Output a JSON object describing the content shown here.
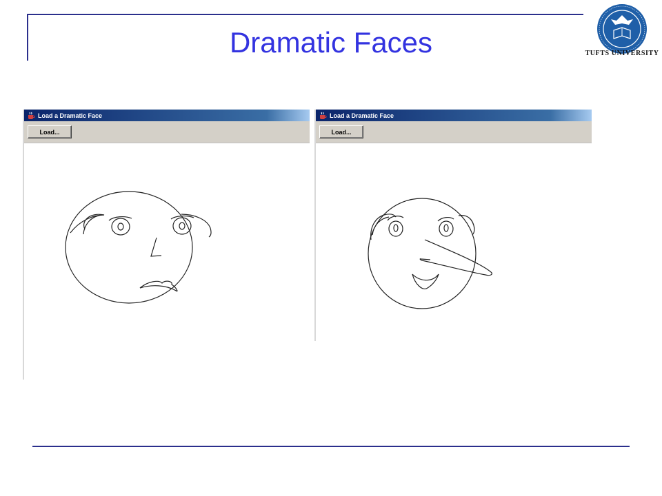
{
  "slide": {
    "title": "Dramatic Faces"
  },
  "branding": {
    "university_name": "TUFTS UNIVERSITY",
    "seal_icon": "tufts-seal-icon",
    "seal_color": "#1f5fa8"
  },
  "windows": [
    {
      "title": "Load a Dramatic Face",
      "load_button": "Load...",
      "face_expression": "sad"
    },
    {
      "title": "Load a Dramatic Face",
      "load_button": "Load...",
      "face_expression": "smiling-long-nose"
    }
  ],
  "colors": {
    "accent_title": "#3333e0",
    "rule": "#2b2f8c",
    "titlebar": "#0a246a"
  }
}
